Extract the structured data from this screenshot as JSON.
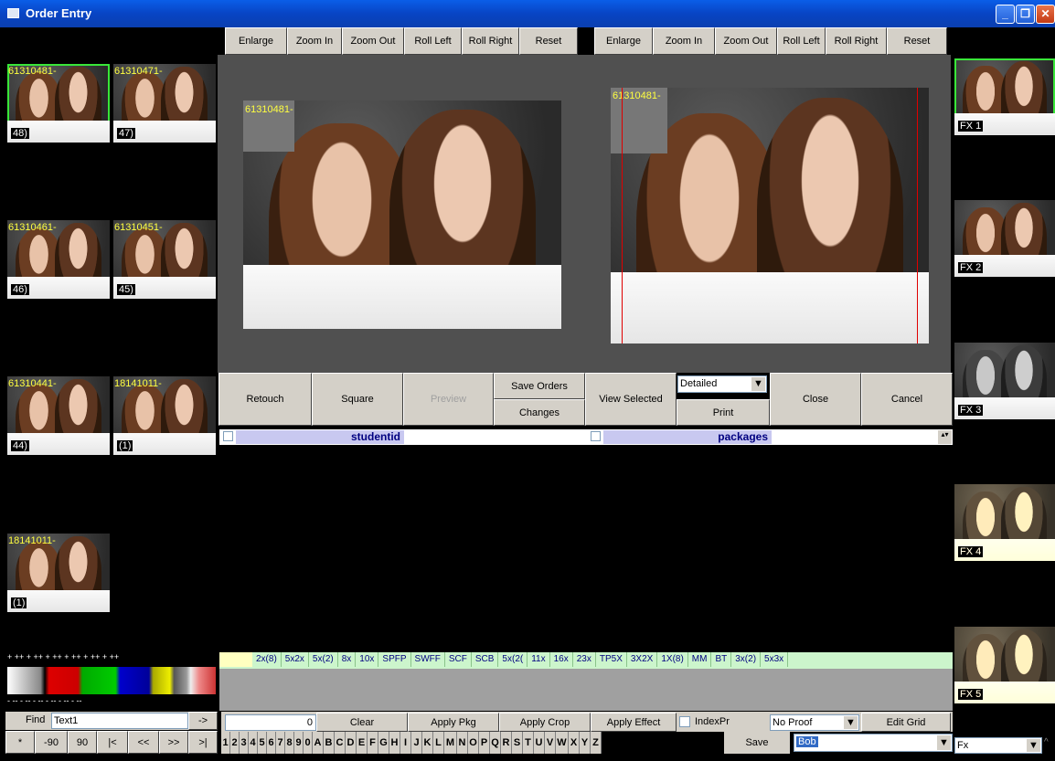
{
  "window": {
    "title": "Order Entry"
  },
  "toolbar_left": [
    "Enlarge",
    "Zoom In",
    "Zoom Out",
    "Roll Left",
    "Roll Right",
    "Reset"
  ],
  "toolbar_right": [
    "Enlarge",
    "Zoom In",
    "Zoom Out",
    "Roll Left",
    "Roll Right",
    "Reset"
  ],
  "thumbs": [
    {
      "id": "61310481-",
      "count": "48)"
    },
    {
      "id": "61310471-",
      "count": "47)"
    },
    {
      "id": "61310461-",
      "count": "46)"
    },
    {
      "id": "61310451-",
      "count": "45)"
    },
    {
      "id": "61310441-",
      "count": "44)"
    },
    {
      "id": "18141011-",
      "count": "(1)"
    },
    {
      "id": "18141011-",
      "count": "(1)"
    }
  ],
  "preview": {
    "left_id": "61310481-",
    "right_id": "61310481-"
  },
  "fx": [
    "FX 1",
    "FX 2",
    "FX 3",
    "FX 4",
    "FX 5"
  ],
  "actions": {
    "retouch": "Retouch",
    "square": "Square",
    "preview": "Preview",
    "save_orders": "Save Orders",
    "changes": "Changes",
    "view_selected": "View Selected",
    "detailed": "Detailed",
    "print": "Print",
    "close": "Close",
    "cancel": "Cancel"
  },
  "grid": {
    "col1": "studentid",
    "col2": "packages"
  },
  "tags": [
    "2x(8)",
    "5x2x",
    "5x(2)",
    "8x",
    "10x",
    "SPFP",
    "SWFF",
    "SCF",
    "SCB",
    "5x(2(",
    "11x",
    "16x",
    "23x",
    "TP5X",
    "3X2X",
    "1X(8)",
    "MM",
    "BT",
    "3x(2)",
    "5x3x"
  ],
  "bottom": {
    "qty": "0",
    "clear": "Clear",
    "apply_pkg": "Apply Pkg",
    "apply_crop": "Apply Crop",
    "apply_effect": "Apply Effect",
    "index_pr": "IndexPr",
    "no_proof": "No Proof",
    "edit_grid": "Edit Grid",
    "save": "Save",
    "bob": "Bob",
    "fx": "Fx"
  },
  "find": {
    "label": "Find",
    "value": "Text1",
    "go": "->"
  },
  "nav": [
    "*",
    "-90",
    "90",
    "|<",
    "<<",
    ">>",
    ">|"
  ],
  "keys": [
    "1",
    "2",
    "3",
    "4",
    "5",
    "6",
    "7",
    "8",
    "9",
    "0",
    "A",
    "B",
    "C",
    "D",
    "E",
    "F",
    "G",
    "H",
    "I",
    "J",
    "K",
    "L",
    "M",
    "N",
    "O",
    "P",
    "Q",
    "R",
    "S",
    "T",
    "U",
    "V",
    "W",
    "X",
    "Y",
    "Z"
  ],
  "swatch": {
    "plus_row": "+ ++ + ++ + ++ + ++ + ++ + ++",
    "minus_row": "- -- - -- - -- - -- - -- - --"
  }
}
